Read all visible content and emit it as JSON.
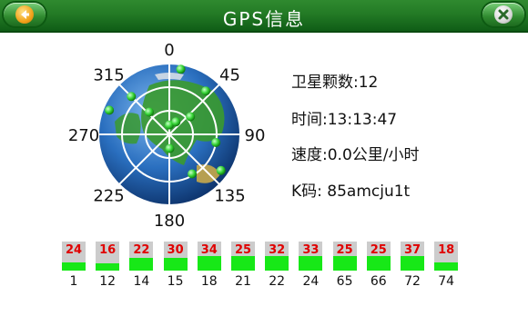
{
  "header": {
    "title": "GPS信息",
    "back_icon": "back-arrow-icon",
    "close_icon": "close-x-icon"
  },
  "skyplot": {
    "bearings": [
      "0",
      "45",
      "90",
      "135",
      "180",
      "225",
      "270",
      "315"
    ],
    "globe_colors": {
      "ocean": "#1f5fb0",
      "land": "#3a9a2e",
      "grid": "#ffffff"
    },
    "satellite_color": "#35d335",
    "satellites": [
      {
        "az": 0,
        "el": 78
      },
      {
        "az": 28,
        "el": 72
      },
      {
        "az": 40,
        "el": 18
      },
      {
        "az": 315,
        "el": 22
      },
      {
        "az": 318,
        "el": 52
      },
      {
        "az": 292,
        "el": 8
      },
      {
        "az": 125,
        "el": 10
      },
      {
        "az": 150,
        "el": 32
      },
      {
        "az": 178,
        "el": 72
      },
      {
        "az": 50,
        "el": 55
      },
      {
        "az": 10,
        "el": 6
      },
      {
        "az": 100,
        "el": 30
      }
    ]
  },
  "info": {
    "satellites_label": "卫星颗数:12",
    "time_label": "时间:13:13:47",
    "speed_label": "速度:0.0公里/小时",
    "kcode_label": "K码: 85amcju1t"
  },
  "signal": {
    "fill_color": "#17e817",
    "bar_bg": "#cccccc",
    "value_color": "#e00000",
    "bars": [
      {
        "prn": "1",
        "snr": "24",
        "level": 0.28
      },
      {
        "prn": "12",
        "snr": "16",
        "level": 0.25
      },
      {
        "prn": "14",
        "snr": "22",
        "level": 0.44
      },
      {
        "prn": "15",
        "snr": "30",
        "level": 0.44
      },
      {
        "prn": "18",
        "snr": "34",
        "level": 0.5
      },
      {
        "prn": "21",
        "snr": "25",
        "level": 0.5
      },
      {
        "prn": "22",
        "snr": "32",
        "level": 0.5
      },
      {
        "prn": "24",
        "snr": "33",
        "level": 0.5
      },
      {
        "prn": "65",
        "snr": "25",
        "level": 0.5
      },
      {
        "prn": "66",
        "snr": "25",
        "level": 0.5
      },
      {
        "prn": "72",
        "snr": "37",
        "level": 0.5
      },
      {
        "prn": "74",
        "snr": "18",
        "level": 0.28
      }
    ]
  }
}
